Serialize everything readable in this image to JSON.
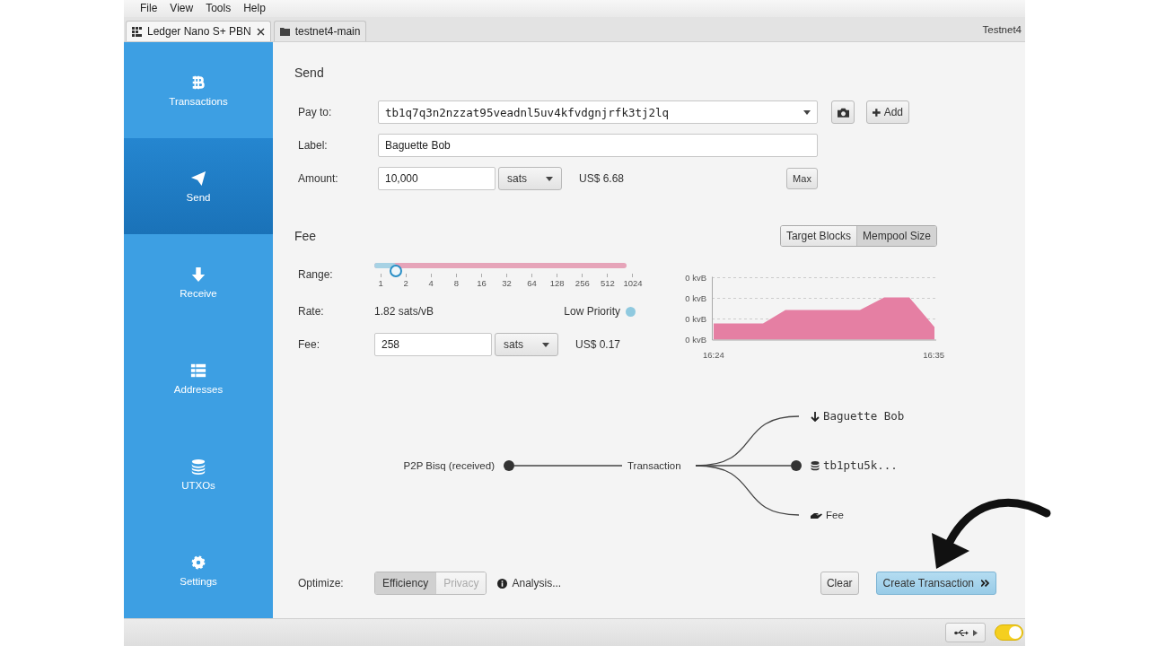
{
  "menu": [
    {
      "label": "File"
    },
    {
      "label": "View"
    },
    {
      "label": "Tools"
    },
    {
      "label": "Help"
    }
  ],
  "tabs": [
    {
      "label": "Ledger Nano S+ PBN",
      "kind": "hardware",
      "selected": true,
      "closable": true
    },
    {
      "label": "testnet4-main",
      "kind": "wallet",
      "selected": false,
      "closable": false
    }
  ],
  "network": "Testnet4",
  "sidebar": {
    "items": [
      {
        "label": "Transactions",
        "kind": "bitcoin",
        "selected": false
      },
      {
        "label": "Send",
        "kind": "send",
        "selected": true
      },
      {
        "label": "Receive",
        "kind": "receive",
        "selected": false
      },
      {
        "label": "Addresses",
        "kind": "addresses",
        "selected": false
      },
      {
        "label": "UTXOs",
        "kind": "utxos",
        "selected": false
      },
      {
        "label": "Settings",
        "kind": "settings",
        "selected": false
      }
    ]
  },
  "send": {
    "title": "Send",
    "pay_to": {
      "label": "Pay to:",
      "value": "tb1q7q3n2nzzat95veadnl5uv4kfvdgnjrfk3tj2lq"
    },
    "add_button": "Add",
    "label_field": {
      "label": "Label:",
      "value": "Baguette Bob"
    },
    "amount": {
      "label": "Amount:",
      "value": "10,000",
      "unit": "sats",
      "fiat": "US$ 6.68"
    },
    "max_button": "Max"
  },
  "fee": {
    "title": "Fee",
    "modes": [
      {
        "label": "Target Blocks",
        "selected": false
      },
      {
        "label": "Mempool Size",
        "selected": true
      }
    ],
    "range": {
      "label": "Range:",
      "level": 0.085,
      "ticks": [
        "1",
        "2",
        "4",
        "8",
        "16",
        "32",
        "64",
        "128",
        "256",
        "512",
        "1024"
      ]
    },
    "rate": {
      "label": "Rate:",
      "value": "1.82 sats/vB",
      "priority": "Low Priority"
    },
    "fee_field": {
      "label": "Fee:",
      "value": "258",
      "unit": "sats",
      "fiat": "US$ 0.17"
    },
    "mempool_chart": {
      "y_labels": [
        "0 kvB",
        "0 kvB",
        "0 kvB",
        "0 kvB"
      ],
      "x_labels": [
        "16:24",
        "16:35"
      ]
    }
  },
  "diagram": {
    "input": "P2P Bisq (received)",
    "center": "Transaction",
    "outputs": [
      {
        "kind": "recipient",
        "label": "Baguette Bob"
      },
      {
        "kind": "change",
        "label": "tb1ptu5k..."
      },
      {
        "kind": "fee",
        "label": "Fee"
      }
    ]
  },
  "optimize": {
    "label": "Optimize:",
    "options": [
      {
        "label": "Efficiency",
        "selected": true,
        "disabled": false
      },
      {
        "label": "Privacy",
        "selected": false,
        "disabled": true
      }
    ],
    "analysis": "Analysis..."
  },
  "actions": [
    {
      "label": "Clear",
      "kind": "plain"
    },
    {
      "label": "Create Transaction",
      "kind": "primary"
    }
  ],
  "status_bar": {
    "toggle_on": true
  }
}
